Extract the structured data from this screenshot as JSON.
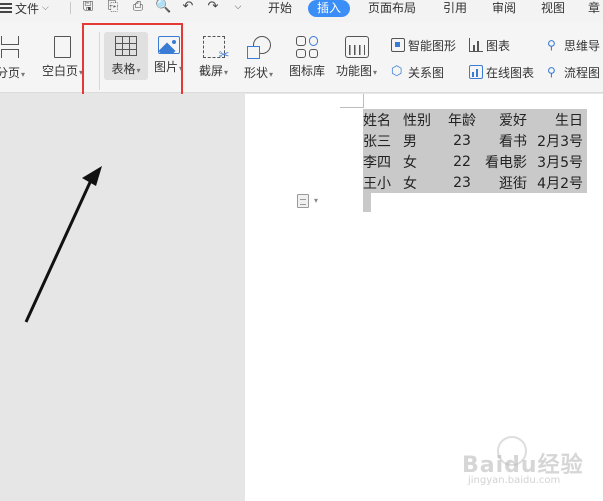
{
  "menu": {
    "file": "文件"
  },
  "tabs": [
    "开始",
    "插入",
    "页面布局",
    "引用",
    "审阅",
    "视图",
    "章"
  ],
  "active_tab": "插入",
  "ribbon": {
    "page_break": "分页",
    "blank_page": "空白页",
    "table": "表格",
    "picture": "图片",
    "screenshot": "截屏",
    "shape": "形状",
    "icon_lib": "图标库",
    "func_chart": "功能图",
    "smart_graphic": "智能图形",
    "chart": "图表",
    "mind_map": "思维导",
    "relation_graph": "关系图",
    "online_chart": "在线图表",
    "flowchart": "流程图"
  },
  "table": {
    "headers": [
      "姓名",
      "性别",
      "年龄",
      "爱好",
      "生日"
    ],
    "rows": [
      [
        "张三",
        "男",
        "23",
        "看书",
        "2月3号"
      ],
      [
        "李四",
        "女",
        "22",
        "看电影",
        "3月5号"
      ],
      [
        "王小",
        "女",
        "23",
        "逛街",
        "4月2号"
      ]
    ]
  },
  "watermark": {
    "main": "Baidu经验",
    "sub": "jingyan.baidu.com"
  },
  "colors": {
    "active_tab": "#3b8ef6",
    "highlight": "#e53935",
    "selection": "#c9c9c9",
    "accent_icon": "#3a7bd5"
  }
}
